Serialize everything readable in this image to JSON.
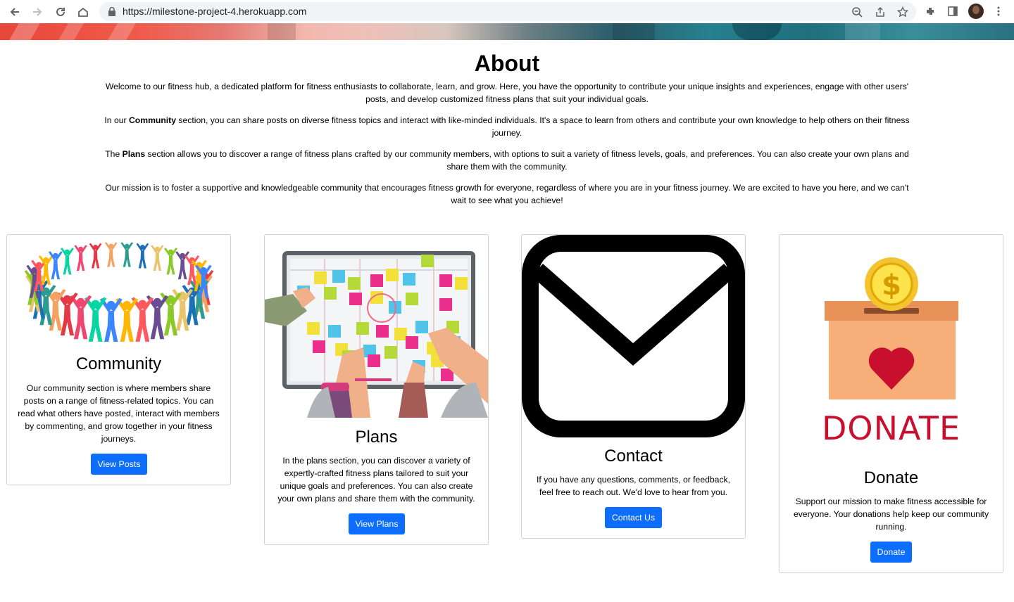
{
  "browser": {
    "url": "https://milestone-project-4.herokuapp.com"
  },
  "about": {
    "title": "About",
    "paragraphs": [
      {
        "text": "Welcome to our fitness hub, a dedicated platform for fitness enthusiasts to collaborate, learn, and grow. Here, you have the opportunity to contribute your unique insights and experiences, engage with other users' posts, and develop customized fitness plans that suit your individual goals."
      },
      {
        "pre": "In our ",
        "bold": "Community",
        "post": " section, you can share posts on diverse fitness topics and interact with like-minded individuals. It's a space to learn from others and contribute your own knowledge to help others on their fitness journey."
      },
      {
        "pre": "The ",
        "bold": "Plans",
        "post": " section allows you to discover a range of fitness plans crafted by our community members, with options to suit a variety of fitness levels, goals, and preferences. You can also create your own plans and share them with the community."
      },
      {
        "text": "Our mission is to foster a supportive and knowledgeable community that encourages fitness growth for everyone, regardless of where you are in your fitness journey. We are excited to have you here, and we can't wait to see what you achieve!"
      }
    ]
  },
  "cards": [
    {
      "title": "Community",
      "text": "Our community section is where members share posts on a range of fitness-related topics. You can read what others have posted, interact with members by commenting, and grow together in your fitness journeys.",
      "button": "View Posts"
    },
    {
      "title": "Plans",
      "text": "In the plans section, you can discover a variety of expertly-crafted fitness plans tailored to suit your unique goals and preferences. You can also create your own plans and share them with the community.",
      "button": "View Plans"
    },
    {
      "title": "Contact",
      "text": "If you have any questions, comments, or feedback, feel free to reach out. We'd love to hear from you.",
      "button": "Contact Us"
    },
    {
      "title": "Donate",
      "text": "Support our mission to make fitness accessible for everyone. Your donations help keep our community running.",
      "button": "Donate",
      "image_text": "DONATE"
    }
  ],
  "colors": {
    "primary": "#0d6efd",
    "donate_red": "#c8102e",
    "box_orange": "#f7ae79"
  }
}
